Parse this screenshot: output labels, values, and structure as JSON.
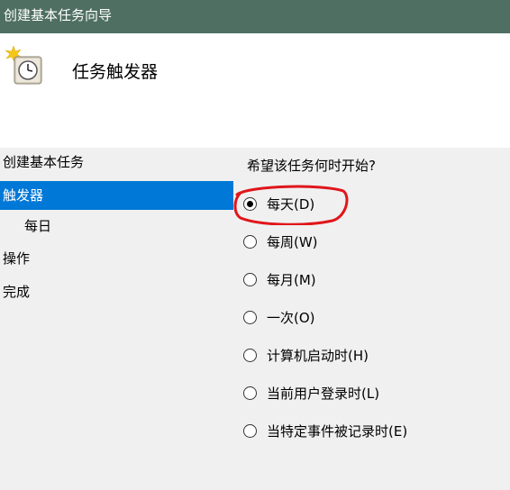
{
  "window": {
    "title": "创建基本任务向导"
  },
  "header": {
    "title": "任务触发器",
    "icon": "clock-task-icon"
  },
  "sidebar": {
    "items": [
      {
        "label": "创建基本任务"
      },
      {
        "label": "触发器",
        "selected": true
      },
      {
        "label": "每日"
      },
      {
        "label": "操作"
      },
      {
        "label": "完成"
      }
    ]
  },
  "main": {
    "question": "希望该任务何时开始?",
    "options": [
      {
        "label": "每天(D)",
        "checked": true
      },
      {
        "label": "每周(W)"
      },
      {
        "label": "每月(M)"
      },
      {
        "label": "一次(O)"
      },
      {
        "label": "计算机启动时(H)"
      },
      {
        "label": "当前用户登录时(L)"
      },
      {
        "label": "当特定事件被记录时(E)"
      }
    ]
  },
  "colors": {
    "titlebar": "#4f6f63",
    "selection": "#0078d7",
    "annotation": "#e0161b"
  }
}
